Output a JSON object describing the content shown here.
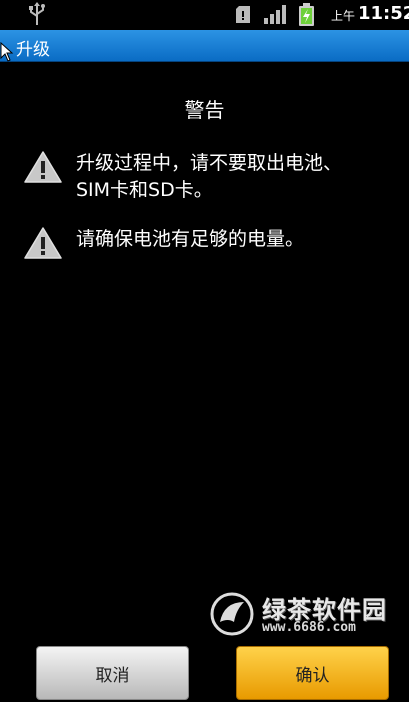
{
  "status_bar": {
    "ampm": "上午",
    "time": "11:52",
    "icons": [
      "usb-icon",
      "sd-card-icon",
      "signal-icon",
      "battery-charging-icon"
    ]
  },
  "title_bar": {
    "title": "升级"
  },
  "dialog": {
    "heading": "警告",
    "warnings": [
      {
        "icon": "warning-icon",
        "text": "升级过程中，请不要取出电池、SIM卡和SD卡。"
      },
      {
        "icon": "warning-icon",
        "text": "请确保电池有足够的电量。"
      }
    ]
  },
  "buttons": {
    "cancel": "取消",
    "confirm": "确认"
  },
  "watermark": {
    "name": "绿茶软件园",
    "url": "www.6686.com"
  },
  "colors": {
    "title_bar": "#1a7fd6",
    "confirm_button": "#f5b820",
    "cancel_button": "#d8d8d8"
  }
}
